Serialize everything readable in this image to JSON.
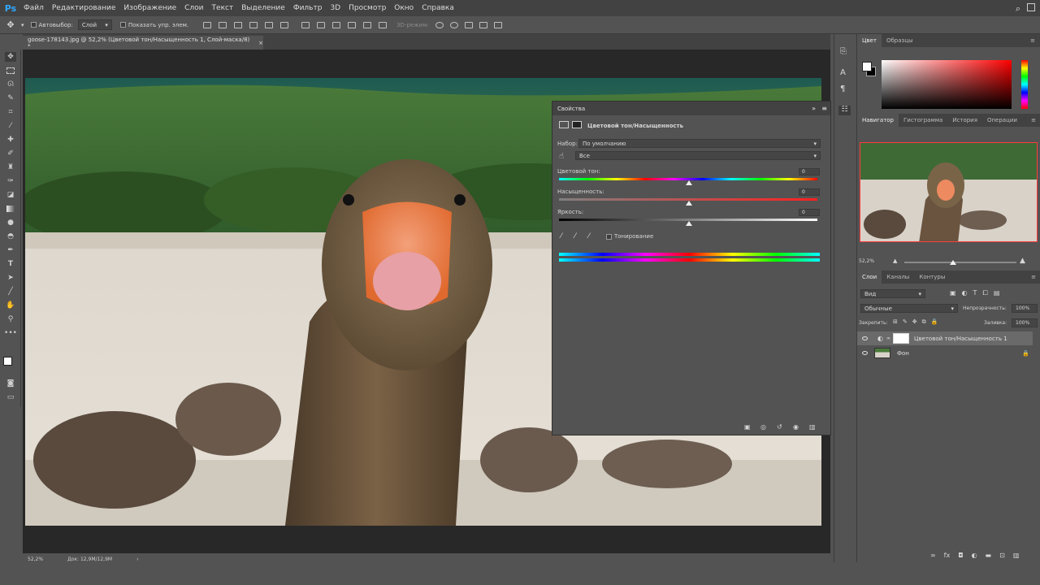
{
  "app": {
    "logo": "Ps"
  },
  "menu": [
    "Файл",
    "Редактирование",
    "Изображение",
    "Слои",
    "Текст",
    "Выделение",
    "Фильтр",
    "3D",
    "Просмотр",
    "Окно",
    "Справка"
  ],
  "options": {
    "autoselect_label": "Автовыбор:",
    "autoselect_value": "Слой",
    "show_controls_label": "Показать упр. элем.",
    "mode_3d": "3D-режим:"
  },
  "document": {
    "tab_title": "goose-178143.jpg @ 52,2% (Цветовой тон/Насыщенность 1, Слой-маска/8) *",
    "close": "×"
  },
  "status": {
    "zoom": "52,2%",
    "doc_info": "Док: 12,9М/12,9М",
    "arrow": "›"
  },
  "properties": {
    "title": "Свойства",
    "adjustment_name": "Цветовой тон/Насыщенность",
    "preset_label": "Набор:",
    "preset_value": "По умолчанию",
    "channel_value": "Все",
    "hue_label": "Цветовой тон:",
    "hue_value": "0",
    "saturation_label": "Насыщенность:",
    "saturation_value": "0",
    "lightness_label": "Яркость:",
    "lightness_value": "0",
    "colorize_label": "Тонирование"
  },
  "color_panel": {
    "tabs": [
      "Цвет",
      "Образцы"
    ],
    "active": 0
  },
  "navigator_panel": {
    "tabs": [
      "Навигатор",
      "Гистограмма",
      "История",
      "Операции"
    ],
    "active": 0,
    "zoom": "52,2%"
  },
  "layers_panel": {
    "tabs": [
      "Слои",
      "Каналы",
      "Контуры"
    ],
    "active": 0,
    "filter_value": "Вид",
    "blend_mode": "Обычные",
    "opacity_label": "Непрозрачность:",
    "opacity_value": "100%",
    "lock_label": "Закрепить:",
    "fill_label": "Заливка:",
    "fill_value": "100%",
    "layers": [
      {
        "name": "Цветовой тон/Насыщенность 1",
        "selected": true
      },
      {
        "name": "Фон",
        "selected": false
      }
    ]
  },
  "colors": {
    "accent": "#31a8ff",
    "panel": "#535353",
    "dark": "#424242"
  }
}
